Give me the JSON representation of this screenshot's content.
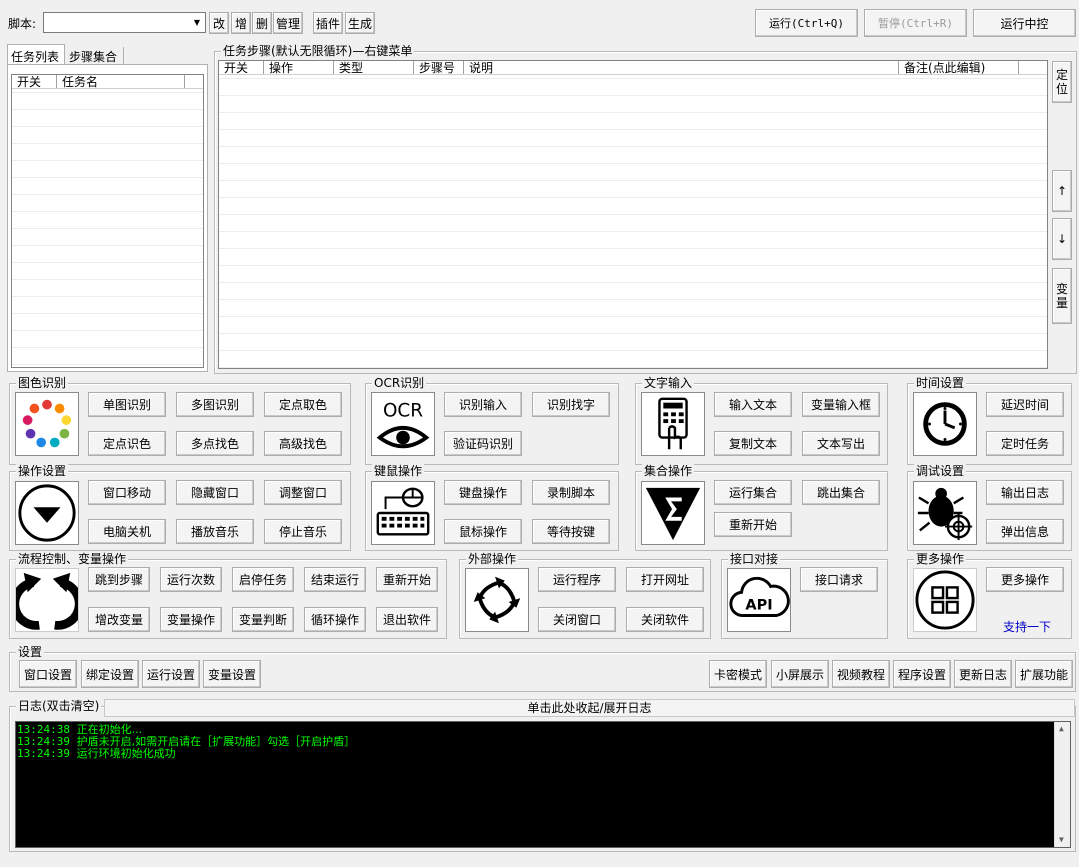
{
  "toolbar": {
    "script_label": "脚本:",
    "script_value": "",
    "edit": "改",
    "add": "增",
    "delete": "删",
    "manage": "管理",
    "plugin": "插件",
    "generate": "生成",
    "run": "运行(Ctrl+Q)",
    "pause": "暂停(Ctrl+R)",
    "run_control": "运行中控"
  },
  "left_tabs": [
    "任务列表",
    "步骤集合"
  ],
  "task_list": {
    "columns": [
      "开关",
      "任务名"
    ]
  },
  "steps": {
    "title": "任务步骤(默认无限循环)—右键菜单",
    "columns": [
      "开关",
      "操作",
      "类型",
      "步骤号",
      "说明",
      "备注(点此编辑)"
    ],
    "side_buttons": {
      "locate": "定位",
      "up": "↑",
      "down": "↓",
      "variable": "变量"
    }
  },
  "groups": {
    "image": {
      "title": "图色识别",
      "buttons": [
        "单图识别",
        "多图识别",
        "定点取色",
        "定点识色",
        "多点找色",
        "高级找色"
      ]
    },
    "ocr": {
      "title": "OCR识别",
      "icon_text": "OCR",
      "buttons": [
        "识别输入",
        "识别找字",
        "验证码识别"
      ]
    },
    "text": {
      "title": "文字输入",
      "buttons": [
        "输入文本",
        "变量输入框",
        "复制文本",
        "文本写出"
      ]
    },
    "time": {
      "title": "时间设置",
      "buttons": [
        "延迟时间",
        "定时任务"
      ]
    },
    "window": {
      "title": "操作设置",
      "buttons": [
        "窗口移动",
        "隐藏窗口",
        "调整窗口",
        "电脑关机",
        "播放音乐",
        "停止音乐"
      ]
    },
    "keymouse": {
      "title": "键鼠操作",
      "buttons": [
        "键盘操作",
        "录制脚本",
        "鼠标操作",
        "等待按键"
      ]
    },
    "collection": {
      "title": "集合操作",
      "buttons": [
        "运行集合",
        "跳出集合",
        "重新开始"
      ]
    },
    "debug": {
      "title": "调试设置",
      "buttons": [
        "输出日志",
        "弹出信息"
      ]
    },
    "flow": {
      "title": "流程控制、变量操作",
      "buttons": [
        "跳到步骤",
        "运行次数",
        "启停任务",
        "结束运行",
        "重新开始",
        "增改变量",
        "变量操作",
        "变量判断",
        "循环操作",
        "退出软件"
      ]
    },
    "external": {
      "title": "外部操作",
      "buttons": [
        "运行程序",
        "打开网址",
        "关闭窗口",
        "关闭软件"
      ]
    },
    "api": {
      "title": "接口对接",
      "icon_text": "API",
      "buttons": [
        "接口请求"
      ]
    },
    "more": {
      "title": "更多操作",
      "buttons": [
        "更多操作"
      ],
      "link": "支持一下"
    }
  },
  "settings": {
    "title": "设置",
    "left_buttons": [
      "窗口设置",
      "绑定设置",
      "运行设置",
      "变量设置"
    ],
    "right_buttons": [
      "卡密模式",
      "小屏展示",
      "视频教程",
      "程序设置",
      "更新日志",
      "扩展功能"
    ]
  },
  "log": {
    "title": "日志(双击清空)",
    "toggle": "单击此处收起/展开日志",
    "lines": [
      {
        "time": "13:24:38",
        "text": "正在初始化..."
      },
      {
        "time": "13:24:39",
        "text": "护盾未开启,如需开启请在［扩展功能］勾选［开启护盾］"
      },
      {
        "time": "13:24:39",
        "text": "运行环境初始化成功"
      }
    ],
    "text_color": "#00ff00",
    "bg_color": "#000000"
  },
  "colors": {
    "link": "#0000cc",
    "disabled": "#9a9a9a"
  }
}
